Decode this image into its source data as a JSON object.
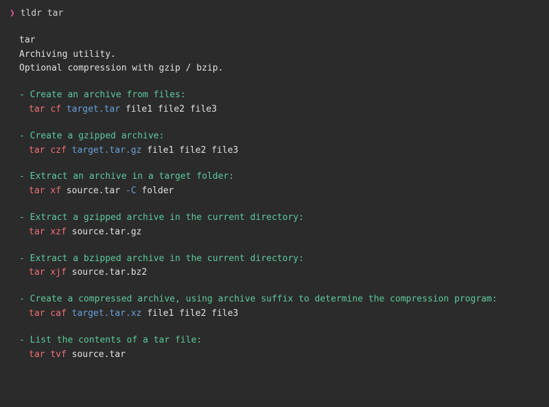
{
  "prompt": {
    "symbol": "❯",
    "command": "tldr tar"
  },
  "header": {
    "title": "tar",
    "desc1": "Archiving utility.",
    "desc2": "Optional compression with gzip / bzip."
  },
  "entries": [
    {
      "desc": "Create an archive from files:",
      "cmd": {
        "red1": "tar",
        "red2": "cf",
        "blue1": "target.tar",
        "white": "file1 file2 file3"
      }
    },
    {
      "desc": "Create a gzipped archive:",
      "cmd": {
        "red1": "tar",
        "red2": "czf",
        "blue1": "target.tar.gz",
        "white": "file1 file2 file3"
      }
    },
    {
      "desc": "Extract an archive in a target folder:",
      "cmd": {
        "red1": "tar",
        "red2": "xf",
        "white1": "source.tar",
        "blue1": "-C",
        "white2": "folder"
      }
    },
    {
      "desc": "Extract a gzipped archive in the current directory:",
      "cmd": {
        "red1": "tar",
        "red2": "xzf",
        "white1": "source.tar.gz"
      }
    },
    {
      "desc": "Extract a bzipped archive in the current directory:",
      "cmd": {
        "red1": "tar",
        "red2": "xjf",
        "white1": "source.tar.bz2"
      }
    },
    {
      "desc": "Create a compressed archive, using archive suffix to determine the compression program:",
      "cmd": {
        "red1": "tar",
        "red2": "caf",
        "blue1": "target.tar.xz",
        "white": "file1 file2 file3"
      }
    },
    {
      "desc": "List the contents of a tar file:",
      "cmd": {
        "red1": "tar",
        "red2": "tvf",
        "white1": "source.tar"
      }
    }
  ]
}
